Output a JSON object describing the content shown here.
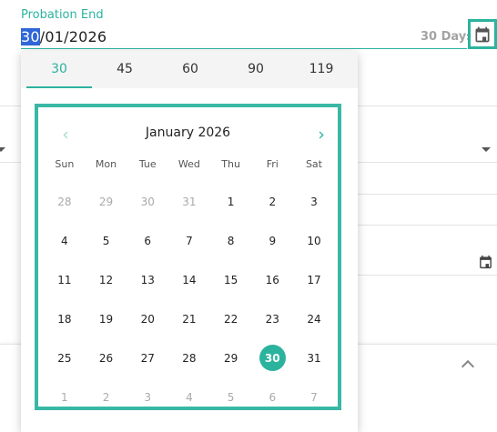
{
  "field": {
    "label": "Probation End",
    "value_selected": "30",
    "value_rest": "/01/2026",
    "days_hint": "30 Days"
  },
  "presets": [
    "30",
    "45",
    "60",
    "90",
    "119"
  ],
  "active_preset": "30",
  "calendar": {
    "month_title": "January 2026",
    "prev_glyph": "‹",
    "next_glyph": "›",
    "weekdays": [
      "Sun",
      "Mon",
      "Tue",
      "Wed",
      "Thu",
      "Fri",
      "Sat"
    ],
    "weeks": [
      [
        {
          "d": "28",
          "m": true
        },
        {
          "d": "29",
          "m": true
        },
        {
          "d": "30",
          "m": true
        },
        {
          "d": "31",
          "m": true
        },
        {
          "d": "1"
        },
        {
          "d": "2"
        },
        {
          "d": "3"
        }
      ],
      [
        {
          "d": "4"
        },
        {
          "d": "5"
        },
        {
          "d": "6"
        },
        {
          "d": "7"
        },
        {
          "d": "8"
        },
        {
          "d": "9"
        },
        {
          "d": "10"
        }
      ],
      [
        {
          "d": "11"
        },
        {
          "d": "12"
        },
        {
          "d": "13"
        },
        {
          "d": "14"
        },
        {
          "d": "15"
        },
        {
          "d": "16"
        },
        {
          "d": "17"
        }
      ],
      [
        {
          "d": "18"
        },
        {
          "d": "19"
        },
        {
          "d": "20"
        },
        {
          "d": "21"
        },
        {
          "d": "22"
        },
        {
          "d": "23"
        },
        {
          "d": "24"
        }
      ],
      [
        {
          "d": "25"
        },
        {
          "d": "26"
        },
        {
          "d": "27"
        },
        {
          "d": "28"
        },
        {
          "d": "29"
        },
        {
          "d": "30",
          "sel": true
        },
        {
          "d": "31"
        }
      ],
      [
        {
          "d": "1",
          "m": true
        },
        {
          "d": "2",
          "m": true
        },
        {
          "d": "3",
          "m": true
        },
        {
          "d": "4",
          "m": true
        },
        {
          "d": "5",
          "m": true
        },
        {
          "d": "6",
          "m": true
        },
        {
          "d": "7",
          "m": true
        }
      ]
    ]
  },
  "colors": {
    "accent": "#2bb39e",
    "selection_highlight": "#2f67d9",
    "muted_text": "#aaaaaa"
  },
  "icons": {
    "field_calendar": "calendar-icon",
    "background_calendar": "calendar-icon",
    "background_dropdowns": "caret-down-icon",
    "background_card_toggle": "chevron-up-icon"
  }
}
